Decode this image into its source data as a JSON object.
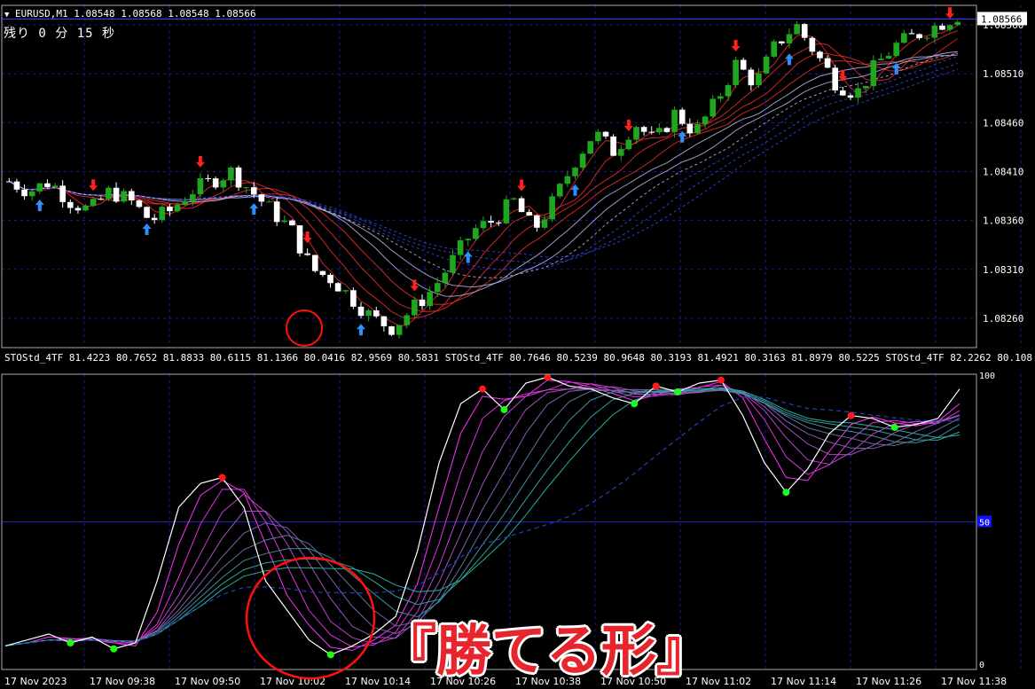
{
  "header": {
    "collapse_icon": "triangle-down-icon",
    "symbol_line": "EURUSD,M1  1.08548 1.08568 1.08548 1.08566",
    "remaining_time": "残り 0 分 15 秒"
  },
  "indicator": {
    "label": "STOStd_4TF 81.4223 80.7652 81.8833 80.6115 81.1366 80.0416 82.9569 80.5831  STOStd_4TF 80.7646 80.5239 80.9648 80.3193 81.4921 80.3163 81.8979 80.5225  STOStd_4TF 82.2262 80.108",
    "levels": [
      "100",
      "50",
      "0"
    ]
  },
  "caption": "『勝てる形』",
  "colors": {
    "background": "#000000",
    "grid": "#1c1c8c",
    "bull_candle": "#1fa81f",
    "bear_candle": "#ffffff",
    "up_arrow": "#2f8fff",
    "down_arrow": "#ff2020",
    "signal_red": "#ff1a1a",
    "signal_green": "#1aff1a",
    "stoch_main": "#ffffff",
    "circle": "#ff1010",
    "level_box": "#1010ff"
  },
  "chart_data": [
    {
      "type": "candlestick",
      "title": "EURUSD,M1",
      "price_axis": [
        "1.08560",
        "1.08510",
        "1.08460",
        "1.08410",
        "1.08360",
        "1.08310",
        "1.08260"
      ],
      "current_price": "1.08566",
      "ylim": [
        1.0823,
        1.0858
      ],
      "time_axis": [
        "17 Nov 2023",
        "17 Nov 09:38",
        "17 Nov 09:50",
        "17 Nov 10:02",
        "17 Nov 10:14",
        "17 Nov 10:26",
        "17 Nov 10:38",
        "17 Nov 10:50",
        "17 Nov 11:02",
        "17 Nov 11:14",
        "17 Nov 11:26",
        "17 Nov 11:38"
      ],
      "close_path": [
        1.084,
        1.0839,
        1.084,
        1.0838,
        1.0837,
        1.0839,
        1.0838,
        1.0836,
        1.0837,
        1.0839,
        1.084,
        1.0841,
        1.0839,
        1.0837,
        1.0835,
        1.0831,
        1.083,
        1.0828,
        1.0826,
        1.0825,
        1.0827,
        1.0829,
        1.0832,
        1.0835,
        1.0836,
        1.0838,
        1.0835,
        1.0838,
        1.0842,
        1.0845,
        1.0843,
        1.0846,
        1.0844,
        1.0847,
        1.0845,
        1.0848,
        1.0852,
        1.085,
        1.0854,
        1.0856,
        1.0853,
        1.085,
        1.0849,
        1.0852,
        1.0854,
        1.0855,
        1.0856,
        1.0857
      ]
    },
    {
      "type": "line",
      "title": "STOStd_4TF",
      "ylim": [
        0,
        100
      ],
      "levels": [
        0,
        50,
        100
      ],
      "main_series": [
        8,
        10,
        12,
        9,
        11,
        7,
        9,
        30,
        55,
        63,
        65,
        55,
        30,
        20,
        10,
        5,
        8,
        12,
        18,
        40,
        70,
        90,
        95,
        88,
        97,
        99,
        96,
        95,
        92,
        90,
        96,
        94,
        97,
        98,
        86,
        70,
        60,
        68,
        80,
        86,
        85,
        82,
        83,
        85,
        95
      ]
    }
  ]
}
